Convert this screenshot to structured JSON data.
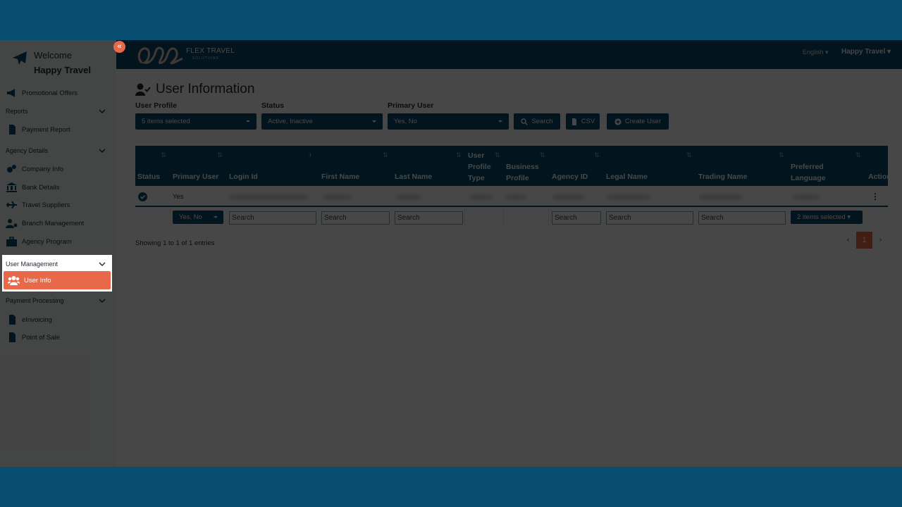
{
  "sidebar": {
    "welcome": "Welcome",
    "agency_name": "Happy Travel",
    "collapse_glyph": "«",
    "promotional_offers": "Promotional Offers",
    "reports": "Reports",
    "payment_report": "Payment Report",
    "agency_details": "Agency Details",
    "company_info": "Company Info",
    "bank_details": "Bank Details",
    "travel_suppliers": "Travel Suppliers",
    "branch_management": "Branch Management",
    "agency_program": "Agency Program",
    "user_management": "User Management",
    "user_info": "User Info",
    "payment_processing": "Payment Processing",
    "einvoicing": "eInvoicing",
    "point_of_sale": "Point of Sale"
  },
  "topbar": {
    "brand": "FLEX TRAVEL",
    "brand_sub": "SOLUTIONS",
    "language": "English ▾",
    "user": "Happy Travel ▾"
  },
  "page": {
    "title": "User Information",
    "filters": {
      "user_profile_label": "User Profile",
      "user_profile_value": "5 items selected",
      "status_label": "Status",
      "status_value": "Active, Inactive",
      "primary_user_label": "Primary User",
      "primary_user_value": "Yes, No"
    },
    "buttons": {
      "search": "Search",
      "csv": "CSV",
      "create_user": "Create User"
    }
  },
  "table": {
    "columns": {
      "status": "Status",
      "primary_user": "Primary User",
      "login_id": "Login Id",
      "first_name": "First Name",
      "last_name": "Last Name",
      "user_profile_type": "User Profile Type",
      "business_profile": "Business Profile",
      "agency_id": "Agency ID",
      "legal_name": "Legal Name",
      "trading_name": "Trading Name",
      "preferred_language": "Preferred Language",
      "action": "Action"
    },
    "row": {
      "primary_user": "Yes"
    },
    "filters": {
      "primary_user": "Yes, No",
      "search_placeholder": "Search",
      "preferred_language": "2 items selected ▾"
    },
    "showing": "Showing 1 to 1 of 1 entries",
    "pager": {
      "prev": "‹",
      "page": "1",
      "next": "›"
    }
  },
  "colors": {
    "brand_dark": "#094e6e",
    "accent": "#e8694a",
    "frame": "#064d70"
  }
}
